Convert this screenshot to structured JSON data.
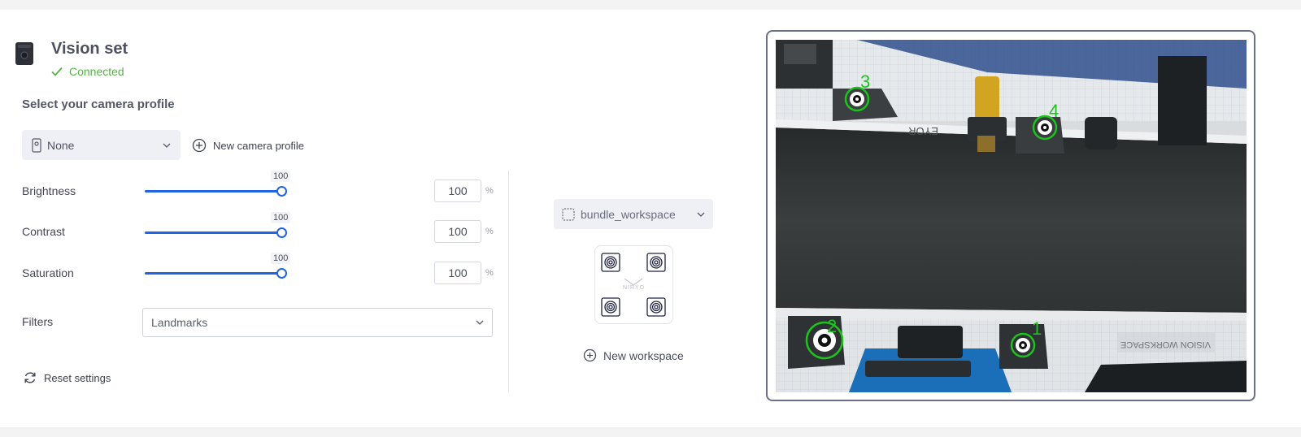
{
  "header": {
    "title": "Vision set",
    "status": "Connected"
  },
  "camera_profile": {
    "section_title": "Select your camera profile",
    "selected": "None",
    "new_label": "New camera profile"
  },
  "sliders": [
    {
      "label": "Brightness",
      "value": 100,
      "input_value": "100",
      "unit": "%"
    },
    {
      "label": "Contrast",
      "value": 100,
      "input_value": "100",
      "unit": "%"
    },
    {
      "label": "Saturation",
      "value": 100,
      "input_value": "100",
      "unit": "%"
    }
  ],
  "filters": {
    "label": "Filters",
    "selected": "Landmarks"
  },
  "reset_label": "Reset settings",
  "workspace": {
    "selected": "bundle_workspace",
    "preview_logo": "NIRYO",
    "new_label": "New workspace"
  },
  "camera_view": {
    "marker_labels": [
      "1",
      "2",
      "3",
      "4"
    ],
    "scene_texts": [
      "VISION WORKSPACE",
      "EYOR"
    ]
  },
  "colors": {
    "accent": "#1f63e6",
    "connected": "#59b04a",
    "marker": "#1ec21e",
    "frame": "#6b6f8a"
  }
}
